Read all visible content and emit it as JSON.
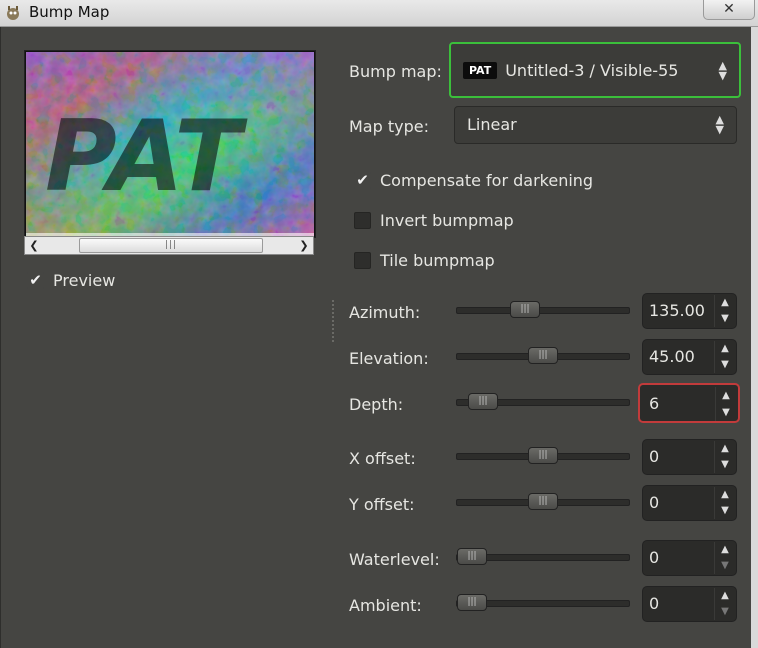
{
  "window": {
    "title": "Bump Map",
    "close_label": "✕"
  },
  "preview": {
    "image_text": "PAT",
    "checkbox_label": "Preview",
    "checked": true
  },
  "bump_map": {
    "label": "Bump map:",
    "badge": "PAT",
    "value": "Untitled-3 / Visible-55"
  },
  "map_type": {
    "label": "Map type:",
    "value": "Linear"
  },
  "options": [
    {
      "label": "Compensate for darkening",
      "checked": true
    },
    {
      "label": "Invert bumpmap",
      "checked": false
    },
    {
      "label": "Tile bumpmap",
      "checked": false
    }
  ],
  "params": [
    {
      "label": "Azimuth:",
      "value": "135.00",
      "level": 0.375
    },
    {
      "label": "Elevation:",
      "value": "45.00",
      "level": 0.5
    },
    {
      "label": "Depth:",
      "value": "6",
      "level": 0.08
    },
    {
      "label": "X offset:",
      "value": "0",
      "level": 0.5
    },
    {
      "label": "Y offset:",
      "value": "0",
      "level": 0.5
    },
    {
      "label": "Waterlevel:",
      "value": "0",
      "level": 0.0
    },
    {
      "label": "Ambient:",
      "value": "0",
      "level": 0.0
    }
  ],
  "colors": {
    "focus_ring": "#3bbf3b",
    "error_ring": "#c23b3b",
    "background": "#454542"
  }
}
